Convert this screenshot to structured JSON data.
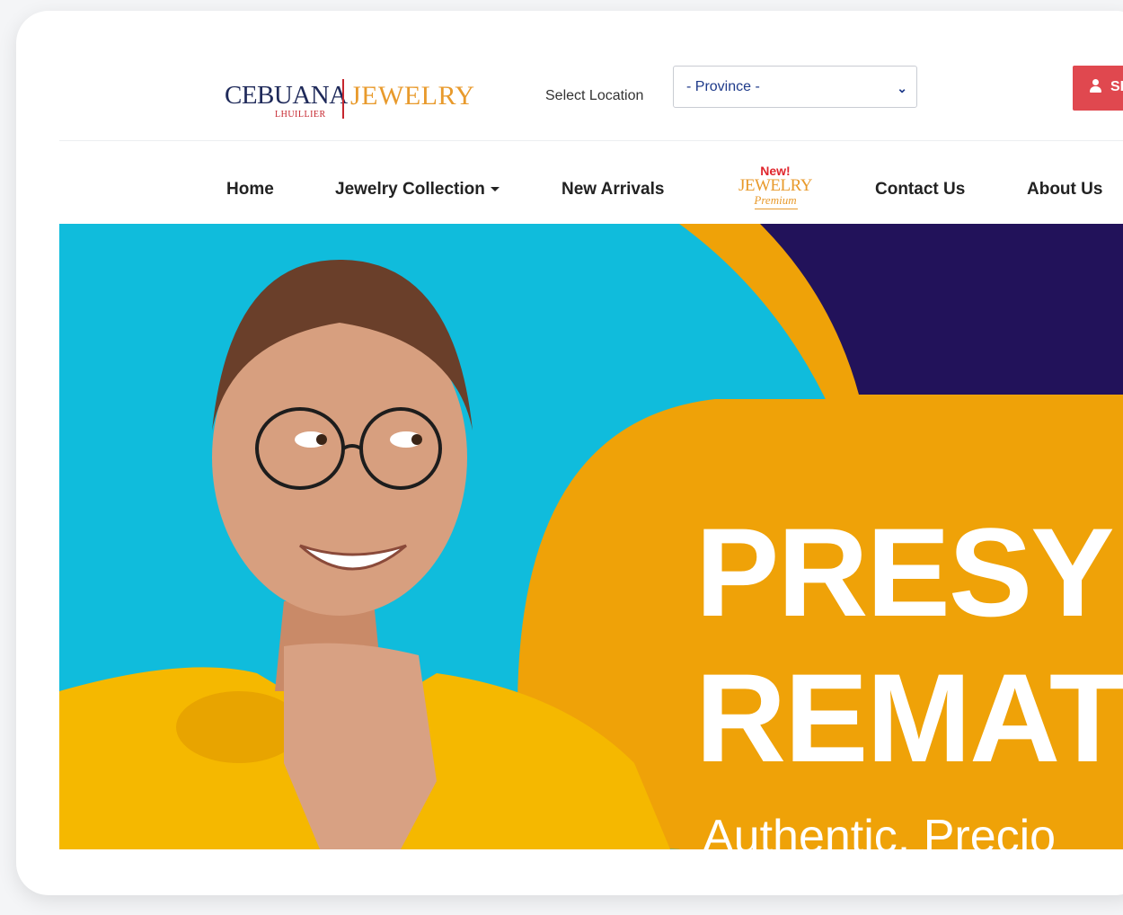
{
  "header": {
    "logo": {
      "brand": "CEBUANA",
      "sub": "LHUILLIER",
      "product": "JEWELRY"
    },
    "location_label": "Select Location",
    "province_select": {
      "value": "- Province -"
    },
    "signin_label": "SI"
  },
  "nav": {
    "items": [
      "Home",
      "Jewelry Collection",
      "New Arrivals",
      "Contact Us",
      "About Us"
    ],
    "premium_badge": {
      "new": "New!",
      "title": "JEWELRY",
      "script": "Premium"
    }
  },
  "banner": {
    "headline_1": "PRESY",
    "headline_2": "REMAT",
    "tagline": "Authentic, Precio",
    "colors": {
      "background": "#10bcdc",
      "orange": "#efa208",
      "navy": "#22125a",
      "shirt": "#f5b800"
    }
  }
}
